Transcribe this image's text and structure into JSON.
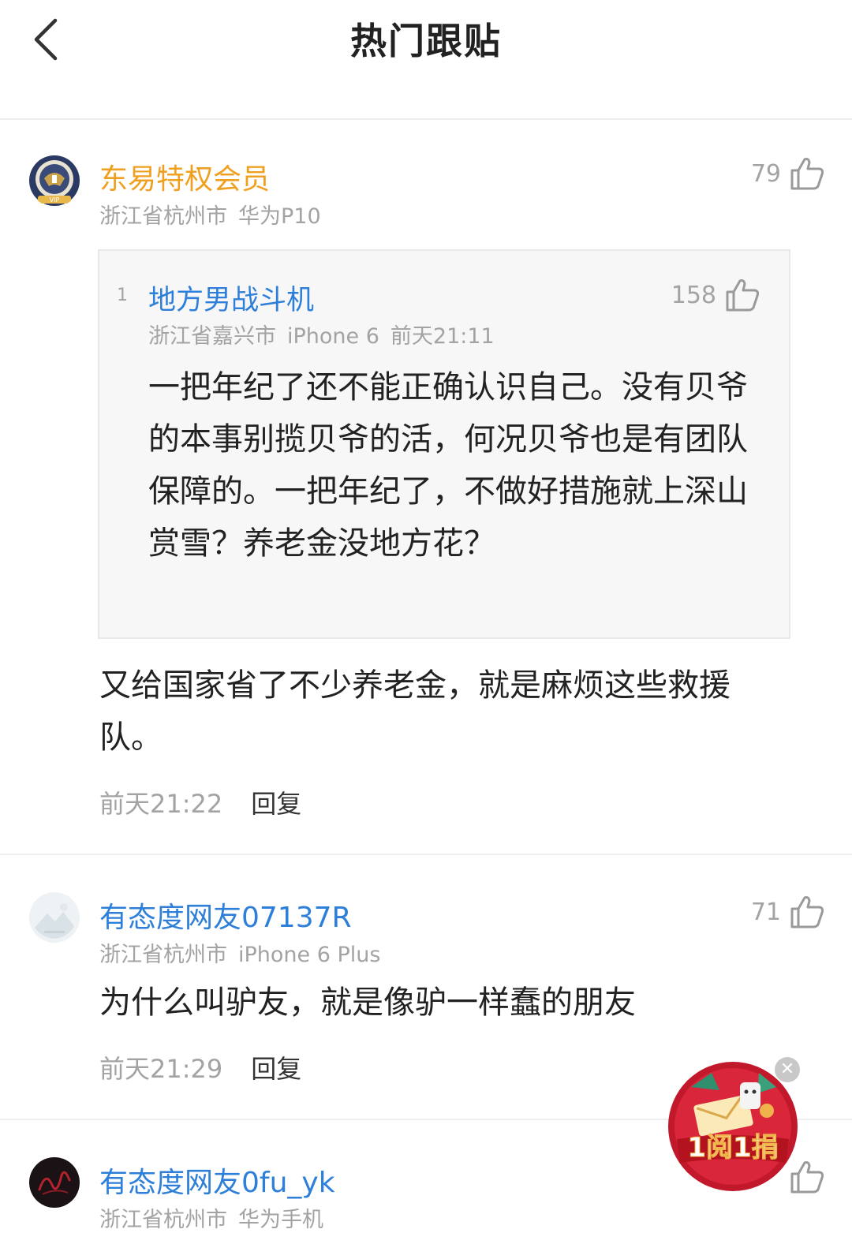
{
  "header": {
    "title": "热门跟贴"
  },
  "comments": [
    {
      "user": "东易特权会员",
      "user_color": "#f0a020",
      "location": "浙江省杭州市",
      "device": "华为P10",
      "likes": "79",
      "text": "又给国家省了不少养老金，就是麻烦这些救援队。",
      "time": "前天21:22",
      "reply": "回复",
      "avatar_badge": "VIP",
      "quote": {
        "floor": "1",
        "user": "地方男战斗机",
        "location": "浙江省嘉兴市",
        "device": "iPhone 6",
        "time": "前天21:11",
        "likes": "158",
        "text": "一把年纪了还不能正确认识自己。没有贝爷的本事别揽贝爷的活，何况贝爷也是有团队保障的。一把年纪了，不做好措施就上深山赏雪？养老金没地方花？"
      }
    },
    {
      "user": "有态度网友07137R",
      "user_color": "#2d7fd9",
      "location": "浙江省杭州市",
      "device": "iPhone 6 Plus",
      "likes": "71",
      "text": "为什么叫驴友，就是像驴一样蠢的朋友",
      "time": "前天21:29",
      "reply": "回复"
    },
    {
      "user": "有态度网友0fu_yk",
      "user_color": "#2d7fd9",
      "location": "浙江省杭州市",
      "device": "华为手机"
    }
  ],
  "promo": {
    "label": "1阅1捐"
  }
}
